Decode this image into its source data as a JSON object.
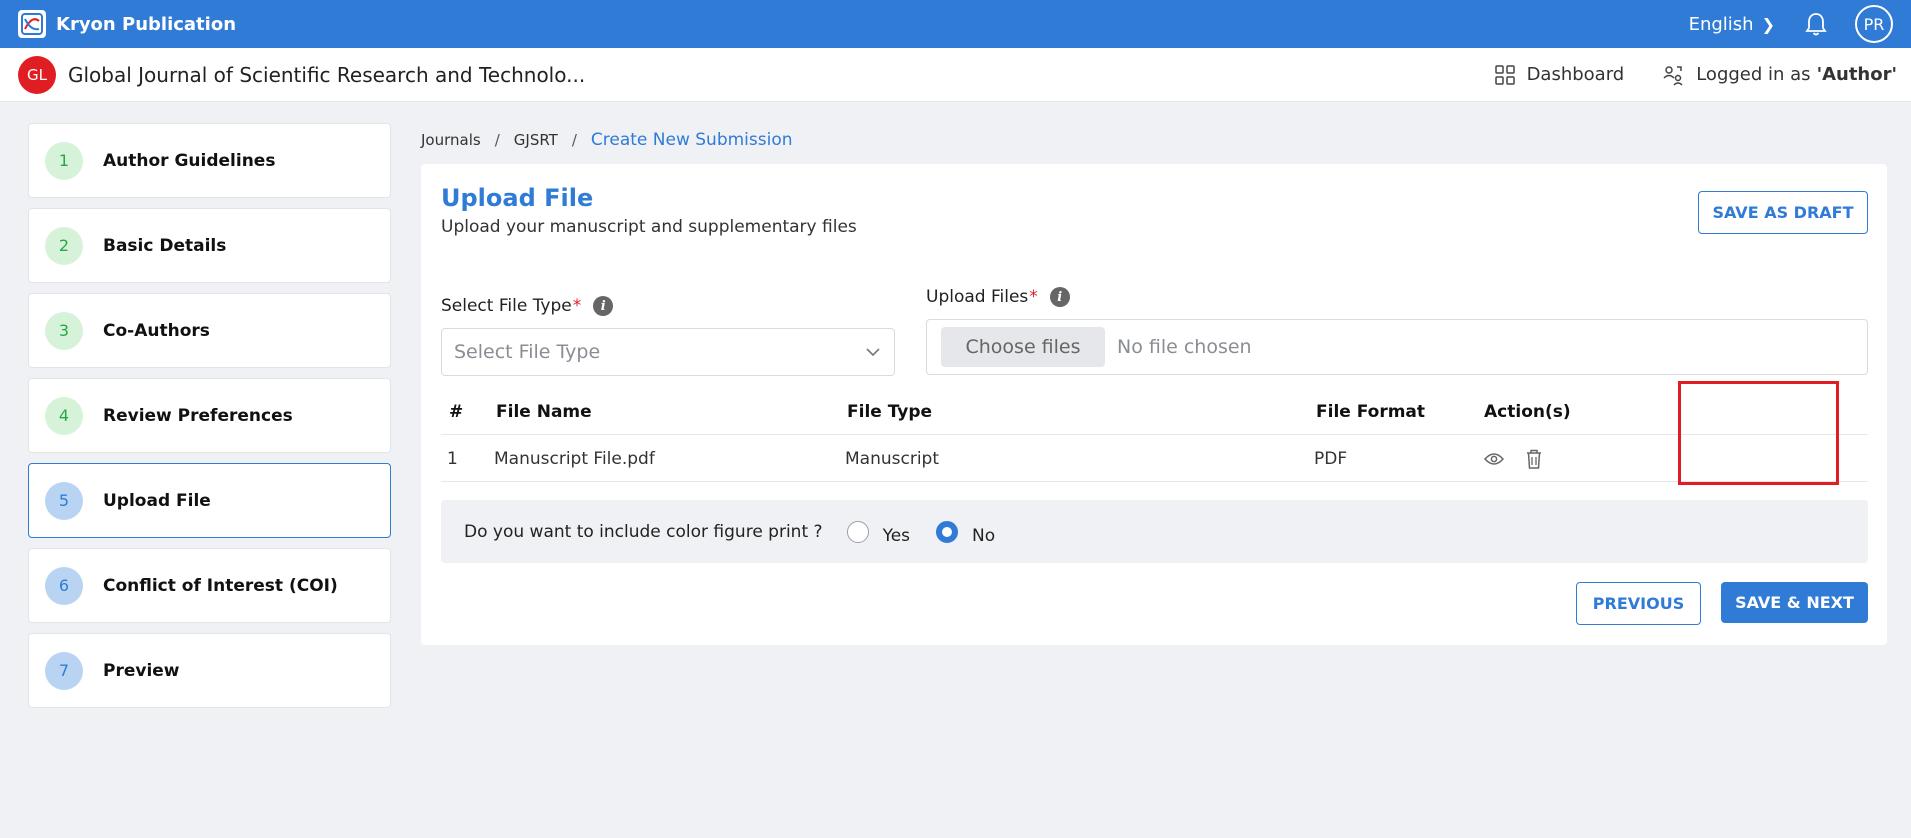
{
  "app": {
    "name": "Kryon Publication",
    "language": "English",
    "user_initials": "PR"
  },
  "journal": {
    "badge": "GL",
    "title": "Global Journal of Scientific Research and Technolo..."
  },
  "header": {
    "dashboard_label": "Dashboard",
    "logged_prefix": "Logged in as",
    "logged_role": "'Author'"
  },
  "steps": [
    {
      "num": "1",
      "label": "Author Guidelines",
      "status": "done"
    },
    {
      "num": "2",
      "label": "Basic Details",
      "status": "done"
    },
    {
      "num": "3",
      "label": "Co-Authors",
      "status": "done"
    },
    {
      "num": "4",
      "label": "Review Preferences",
      "status": "done"
    },
    {
      "num": "5",
      "label": "Upload File",
      "status": "active"
    },
    {
      "num": "6",
      "label": "Conflict of Interest (COI)",
      "status": "todo"
    },
    {
      "num": "7",
      "label": "Preview",
      "status": "todo"
    }
  ],
  "breadcrumb": [
    "Journals",
    "GJSRT",
    "Create New Submission"
  ],
  "upload": {
    "title": "Upload File",
    "subtitle": "Upload your manuscript and supplementary files",
    "save_draft": "SAVE AS DRAFT",
    "file_type_label": "Select File Type",
    "file_type_placeholder": "Select File Type",
    "upload_files_label": "Upload Files",
    "choose_files": "Choose files",
    "no_file": "No file chosen"
  },
  "table": {
    "headers": [
      "#",
      "File Name",
      "File Type",
      "File Format",
      "Action(s)"
    ],
    "rows": [
      {
        "num": "1",
        "name": "Manuscript File.pdf",
        "type": "Manuscript",
        "format": "PDF"
      }
    ]
  },
  "color_print": {
    "question": "Do you want to include color figure print ?",
    "yes": "Yes",
    "no": "No",
    "selected": "No"
  },
  "footer": {
    "previous": "PREVIOUS",
    "save_next": "SAVE & NEXT"
  },
  "colors": {
    "primary": "#2f7bd6",
    "danger": "#e11d24",
    "done_bg": "#d6f2d9",
    "done_fg": "#27a844"
  }
}
